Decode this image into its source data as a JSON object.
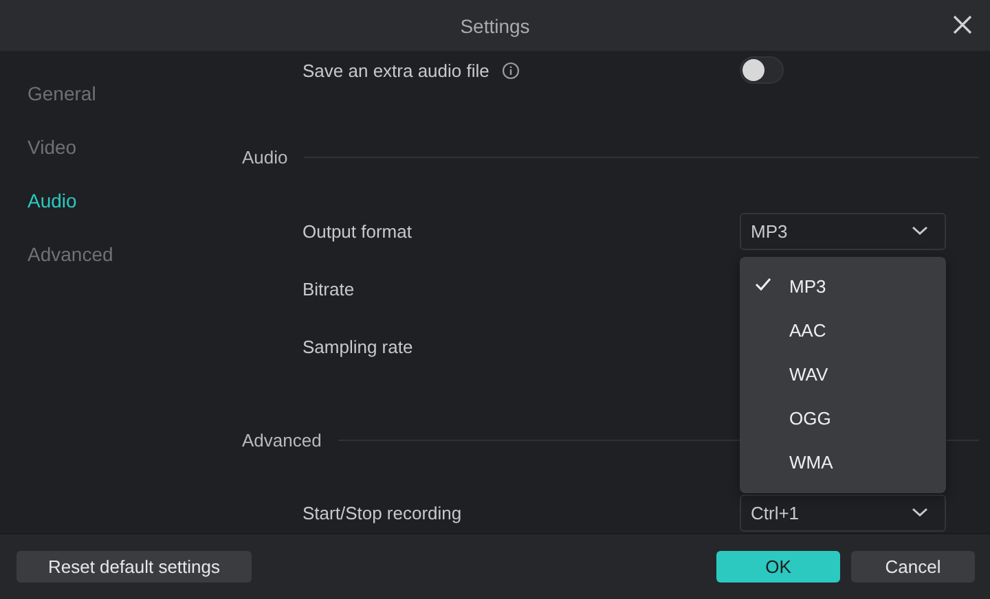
{
  "window": {
    "title": "Settings"
  },
  "sidebar": {
    "items": [
      {
        "label": "General",
        "selected": false
      },
      {
        "label": "Video",
        "selected": false
      },
      {
        "label": "Audio",
        "selected": true
      },
      {
        "label": "Advanced",
        "selected": false
      }
    ]
  },
  "top_rows": [
    {
      "kind": "toggle",
      "label": "Save an extra audio file",
      "on": false
    }
  ],
  "sections": [
    {
      "title": "Audio",
      "rows": [
        {
          "kind": "select",
          "label": "Output format",
          "value": "MP3"
        },
        {
          "kind": "plain",
          "label": "Bitrate"
        },
        {
          "kind": "plain",
          "label": "Sampling rate"
        }
      ]
    },
    {
      "title": "Advanced",
      "rows": [
        {
          "kind": "select",
          "label": "Start/Stop recording",
          "value": "Ctrl+1"
        }
      ]
    }
  ],
  "dropdown": {
    "options": [
      {
        "label": "MP3",
        "selected": true
      },
      {
        "label": "AAC",
        "selected": false
      },
      {
        "label": "WAV",
        "selected": false
      },
      {
        "label": "OGG",
        "selected": false
      },
      {
        "label": "WMA",
        "selected": false
      }
    ]
  },
  "footer": {
    "buttons": [
      {
        "label": "Reset default settings",
        "kind": "secondary"
      },
      {
        "label": "OK",
        "kind": "primary"
      },
      {
        "label": "Cancel",
        "kind": "secondary"
      }
    ]
  }
}
